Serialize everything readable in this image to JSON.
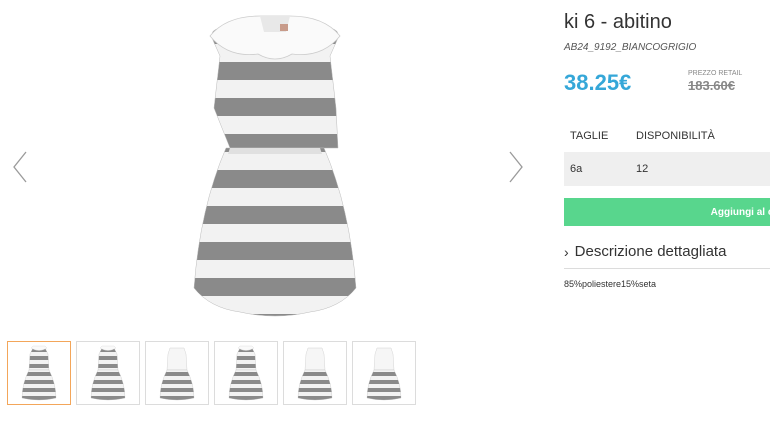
{
  "product": {
    "title": "ki 6 - abitino",
    "sku": "AB24_9192_BIANCOGRIGIO",
    "price": "38.25€",
    "retail_label": "PREZZO RETAIL",
    "retail_price": "183.60€"
  },
  "sizes": {
    "header_size": "TAGLIE",
    "header_availability": "DISPONIBILITÀ",
    "rows": [
      {
        "size": "6a",
        "availability": "12"
      }
    ]
  },
  "cart": {
    "label": "Aggiungi al carrello"
  },
  "description": {
    "toggle_label": "Descrizione dettagliata",
    "composition": "85%poliestere15%seta"
  },
  "gallery": {
    "thumbnail_count": 6,
    "active_thumbnail": 1,
    "colors": {
      "stripe_grey": "#8a8a8a",
      "stripe_white": "#f2f2f2",
      "active_border": "#f3a65a"
    }
  },
  "theme": {
    "price_color": "#35a7d8",
    "cart_color": "#58d68d"
  },
  "icons": {
    "prev": "chevron-left-icon",
    "next": "chevron-right-icon",
    "expand": "chevron-right-icon"
  }
}
